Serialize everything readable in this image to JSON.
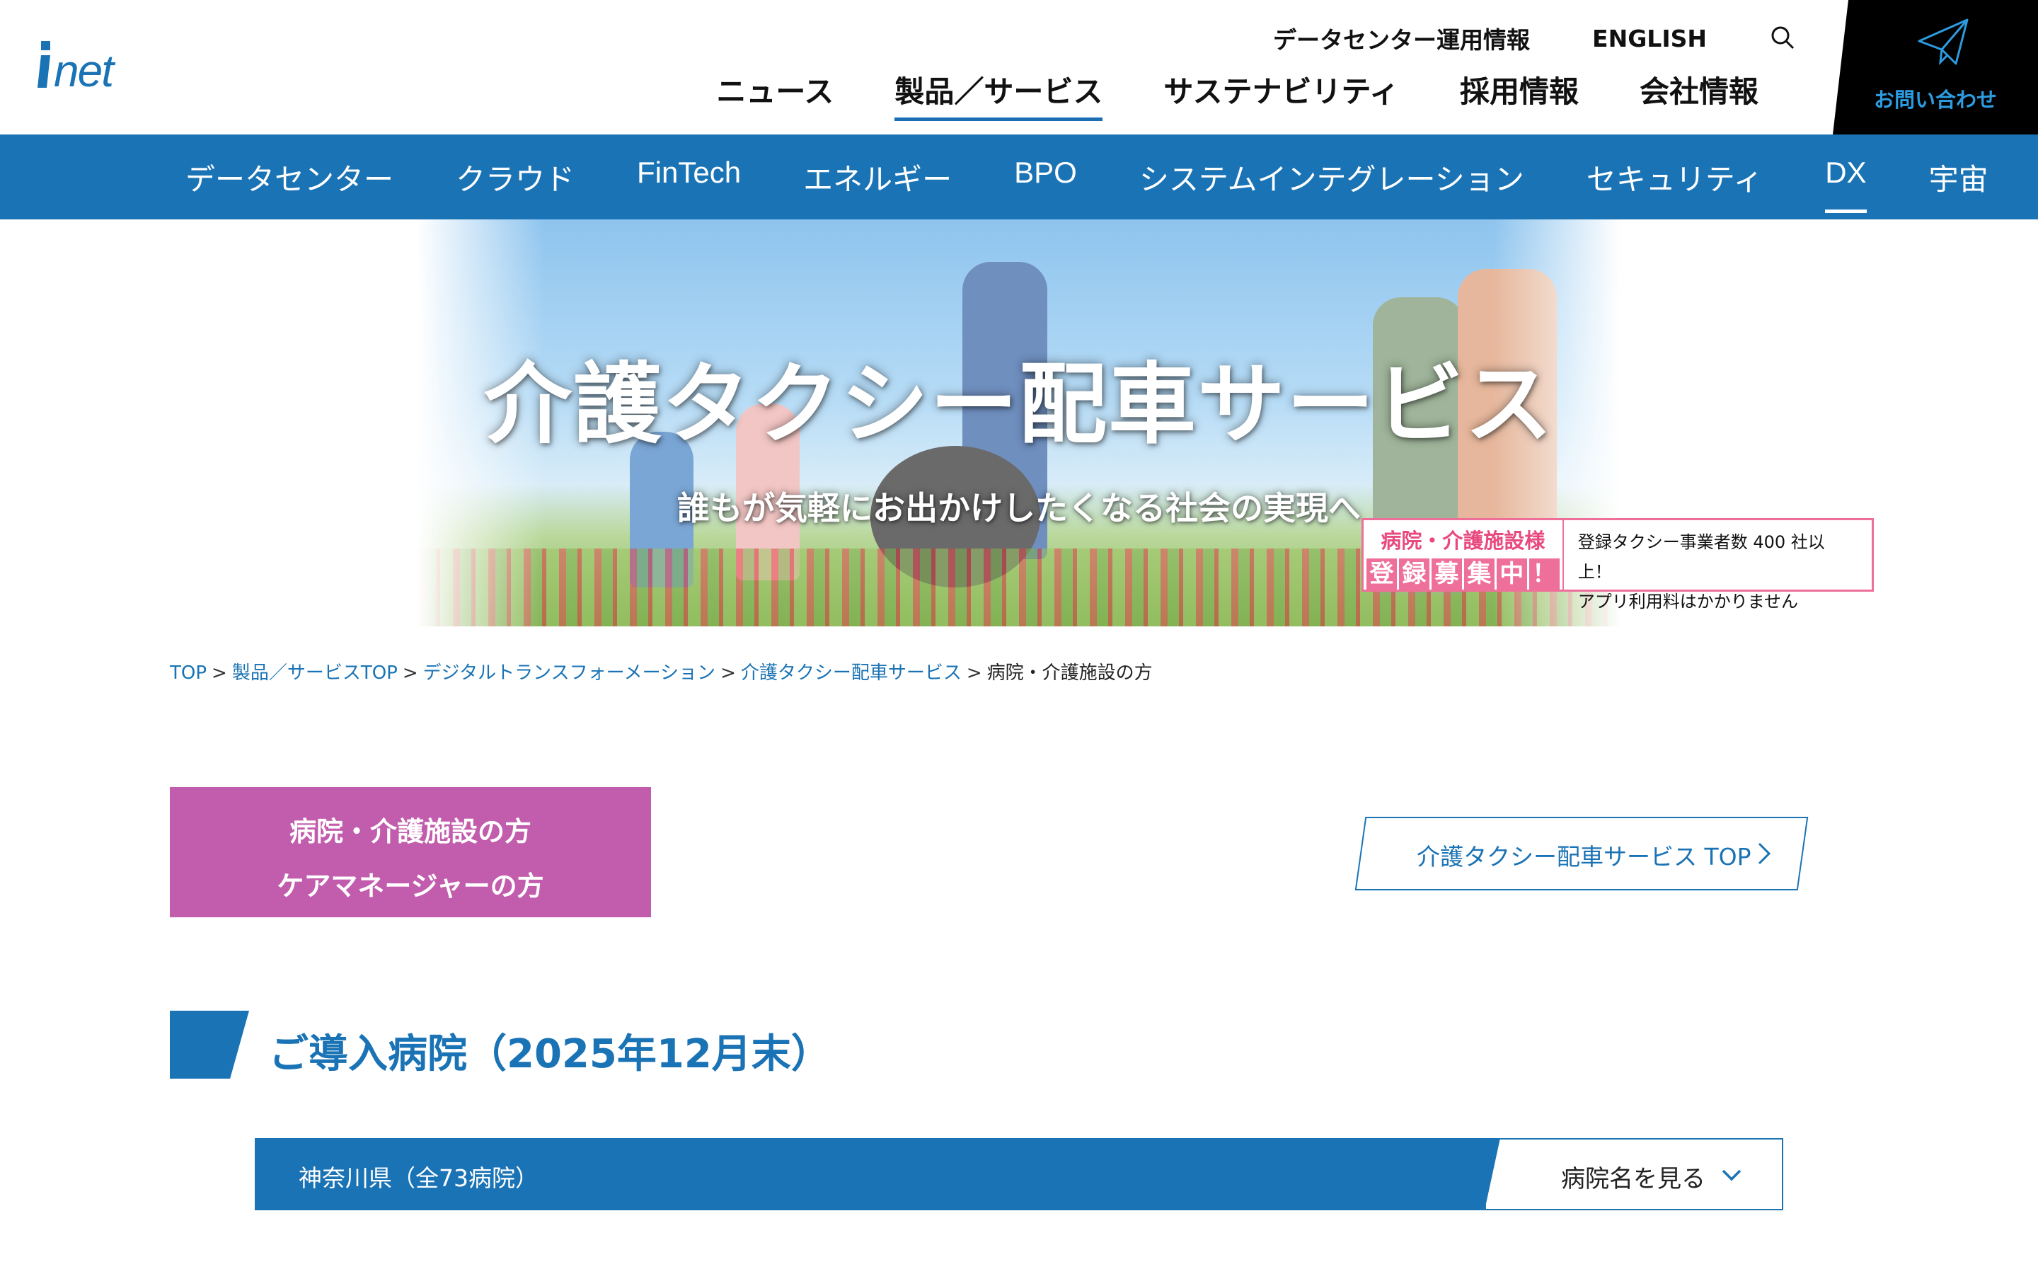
{
  "brand": {
    "logo_text": "inet",
    "accent": "#1a73b5",
    "pink": "#ef6f9b",
    "purple": "#c25cad"
  },
  "util_nav": {
    "dc_info": "データセンター運用情報",
    "english": "ENGLISH",
    "search_icon": "search-icon"
  },
  "main_nav": [
    {
      "label": "ニュース"
    },
    {
      "label": "製品／サービス",
      "active": true
    },
    {
      "label": "サステナビリティ"
    },
    {
      "label": "採用情報"
    },
    {
      "label": "会社情報"
    }
  ],
  "contact": {
    "label": "お問い合わせ",
    "icon": "paper-plane-icon"
  },
  "categories": [
    {
      "label": "データセンター"
    },
    {
      "label": "クラウド"
    },
    {
      "label": "FinTech"
    },
    {
      "label": "エネルギー"
    },
    {
      "label": "BPO"
    },
    {
      "label": "システムインテグレーション"
    },
    {
      "label": "セキュリティ"
    },
    {
      "label": "DX",
      "active": true
    },
    {
      "label": "宇宙"
    }
  ],
  "hero": {
    "title": "介護タクシー配車サービス",
    "subtitle": "誰もが気軽にお出かけしたくなる社会の実現へ"
  },
  "promo": {
    "heading": "病院・介護施設様",
    "chars": [
      "登",
      "録",
      "募",
      "集",
      "中",
      "！"
    ],
    "line1": "登録タクシー事業者数 400 社以上！",
    "line2": "アプリ利用料はかかりません"
  },
  "breadcrumb": {
    "items": [
      "TOP",
      "製品／サービスTOP",
      "デジタルトランスフォーメーション",
      "介護タクシー配車サービス"
    ],
    "current": "病院・介護施設の方",
    "separator": ">"
  },
  "role_box": {
    "line1": "病院・介護施設の方",
    "line2": "ケアマネージャーの方"
  },
  "top_link": {
    "label": "介護タクシー配車サービス TOP"
  },
  "section": {
    "title": "ご導入病院（2025年12月末）"
  },
  "prefecture": {
    "name": "神奈川県（全73病院）",
    "toggle_label": "病院名を見る"
  }
}
